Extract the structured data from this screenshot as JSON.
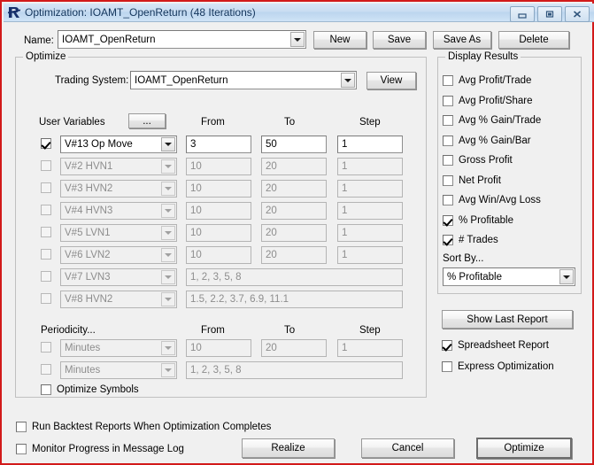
{
  "window": {
    "title": "Optimization: IOAMT_OpenReturn (48 Iterations)",
    "app_icon": "r-logo-icon",
    "border_color": "#d21a1a",
    "controls": {
      "minimize": "minimize-icon",
      "maximize": "maximize-icon",
      "close": "close-icon"
    }
  },
  "top": {
    "name_label": "Name:",
    "name_value": "IOAMT_OpenReturn",
    "buttons": {
      "new": "New",
      "save": "Save",
      "save_as": "Save As",
      "delete": "Delete"
    }
  },
  "optimize": {
    "group_title": "Optimize",
    "trading_system_label": "Trading System:",
    "trading_system_value": "IOAMT_OpenReturn",
    "view_button": "View",
    "user_variables_label": "User Variables",
    "ellipsis_button": "...",
    "col_from": "From",
    "col_to": "To",
    "col_step": "Step",
    "rows": [
      {
        "checked": true,
        "enabled": true,
        "variable": "V#13  Op Move",
        "from": "3",
        "to": "50",
        "step": "1",
        "wide": false
      },
      {
        "checked": false,
        "enabled": false,
        "variable": "V#2  HVN1",
        "from": "10",
        "to": "20",
        "step": "1",
        "wide": false
      },
      {
        "checked": false,
        "enabled": false,
        "variable": "V#3  HVN2",
        "from": "10",
        "to": "20",
        "step": "1",
        "wide": false
      },
      {
        "checked": false,
        "enabled": false,
        "variable": "V#4  HVN3",
        "from": "10",
        "to": "20",
        "step": "1",
        "wide": false
      },
      {
        "checked": false,
        "enabled": false,
        "variable": "V#5  LVN1",
        "from": "10",
        "to": "20",
        "step": "1",
        "wide": false
      },
      {
        "checked": false,
        "enabled": false,
        "variable": "V#6  LVN2",
        "from": "10",
        "to": "20",
        "step": "1",
        "wide": false
      },
      {
        "checked": false,
        "enabled": false,
        "variable": "V#7  LVN3",
        "list": "1, 2, 3, 5, 8",
        "wide": true
      },
      {
        "checked": false,
        "enabled": false,
        "variable": "V#8  HVN2",
        "list": "1.5, 2.2, 3.7, 6.9, 11.1",
        "wide": true
      }
    ],
    "periodicity_label": "Periodicity...",
    "p_col_from": "From",
    "p_col_to": "To",
    "p_col_step": "Step",
    "periodicity_rows": [
      {
        "checked": false,
        "enabled": false,
        "unit": "Minutes",
        "from": "10",
        "to": "20",
        "step": "1",
        "wide": false
      },
      {
        "checked": false,
        "enabled": false,
        "unit": "Minutes",
        "list": "1, 2, 3, 5, 8",
        "wide": true
      }
    ],
    "optimize_symbols": "Optimize Symbols",
    "optimize_symbols_checked": false
  },
  "display_results": {
    "group_title": "Display Results",
    "checkboxes": [
      {
        "label": "Avg Profit/Trade",
        "checked": false
      },
      {
        "label": "Avg Profit/Share",
        "checked": false
      },
      {
        "label": "Avg % Gain/Trade",
        "checked": false
      },
      {
        "label": "Avg % Gain/Bar",
        "checked": false
      },
      {
        "label": "Gross Profit",
        "checked": false
      },
      {
        "label": "Net Profit",
        "checked": false
      },
      {
        "label": "Avg Win/Avg Loss",
        "checked": false
      },
      {
        "label": "% Profitable",
        "checked": true
      },
      {
        "label": "# Trades",
        "checked": true
      }
    ],
    "sort_by_label": "Sort By...",
    "sort_by_value": "% Profitable"
  },
  "right_panel": {
    "show_last_report": "Show Last Report",
    "spreadsheet_report": "Spreadsheet Report",
    "spreadsheet_report_checked": true,
    "express_optimization": "Express Optimization",
    "express_optimization_checked": false
  },
  "footer": {
    "run_backtest": "Run Backtest Reports When Optimization Completes",
    "run_backtest_checked": false,
    "monitor_progress": "Monitor Progress in Message Log",
    "monitor_progress_checked": false,
    "realize": "Realize",
    "cancel": "Cancel",
    "optimize": "Optimize"
  }
}
